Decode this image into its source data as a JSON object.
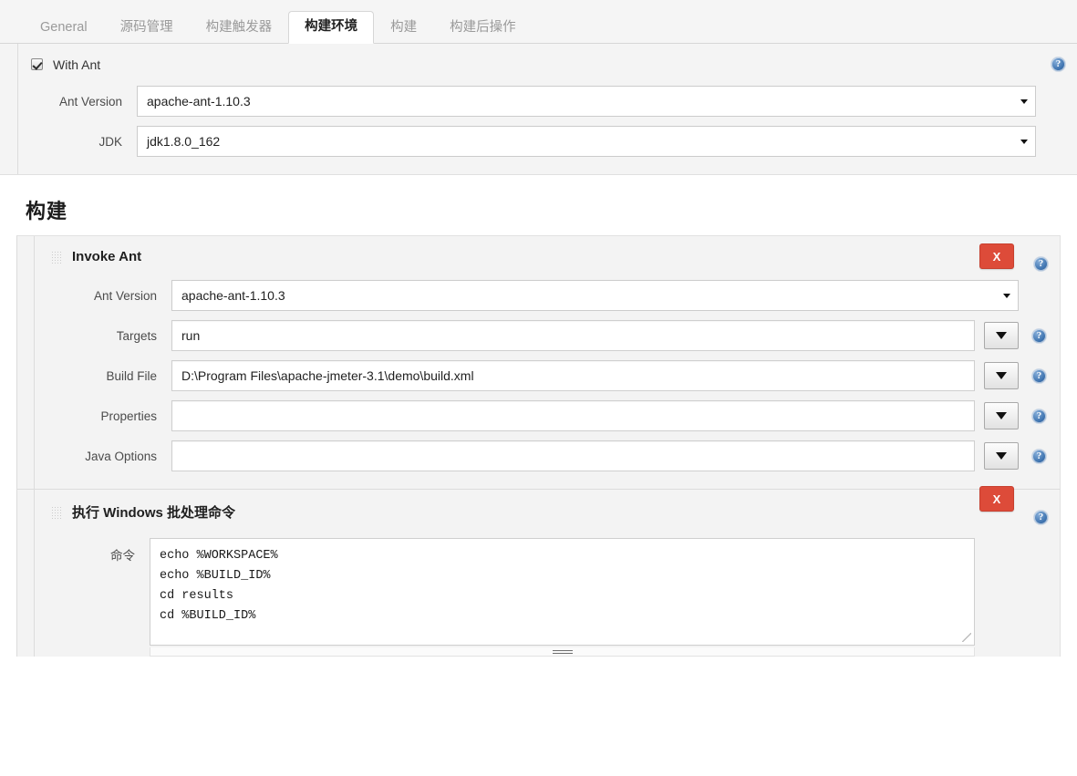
{
  "tabs": [
    {
      "label": "General",
      "active": false
    },
    {
      "label": "源码管理",
      "active": false
    },
    {
      "label": "构建触发器",
      "active": false
    },
    {
      "label": "构建环境",
      "active": true
    },
    {
      "label": "构建",
      "active": false
    },
    {
      "label": "构建后操作",
      "active": false
    }
  ],
  "icons": {
    "help": "?",
    "delete": "X",
    "dropdown_arrow": "▼",
    "grip": "drag-handle"
  },
  "build_environment": {
    "with_ant": {
      "label": "With Ant",
      "checked": true,
      "fields": [
        {
          "label": "Ant Version",
          "value": "apache-ant-1.10.3",
          "type": "select"
        },
        {
          "label": "JDK",
          "value": "jdk1.8.0_162",
          "type": "select"
        }
      ]
    }
  },
  "build_section": {
    "heading": "构建",
    "builders": [
      {
        "title": "Invoke Ant",
        "delete_label": "X",
        "fields": [
          {
            "label": "Ant Version",
            "value": "apache-ant-1.10.3",
            "type": "select"
          },
          {
            "label": "Targets",
            "value": "run",
            "type": "text-with-dropdown"
          },
          {
            "label": "Build File",
            "value": "D:\\Program Files\\apache-jmeter-3.1\\demo\\build.xml",
            "type": "text-with-dropdown"
          },
          {
            "label": "Properties",
            "value": "",
            "type": "text-with-dropdown"
          },
          {
            "label": "Java Options",
            "value": "",
            "type": "text-with-dropdown"
          }
        ]
      },
      {
        "title": "执行 Windows 批处理命令",
        "delete_label": "X",
        "command_label": "命令",
        "command_value": "echo %WORKSPACE%\necho %BUILD_ID%\ncd results\ncd %BUILD_ID%"
      }
    ]
  },
  "colors": {
    "accent_delete": "#dd4b39",
    "help_blue": "#3f74b0",
    "tab_active_text": "#1f1f1f",
    "panel_bg": "#f3f3f3"
  }
}
